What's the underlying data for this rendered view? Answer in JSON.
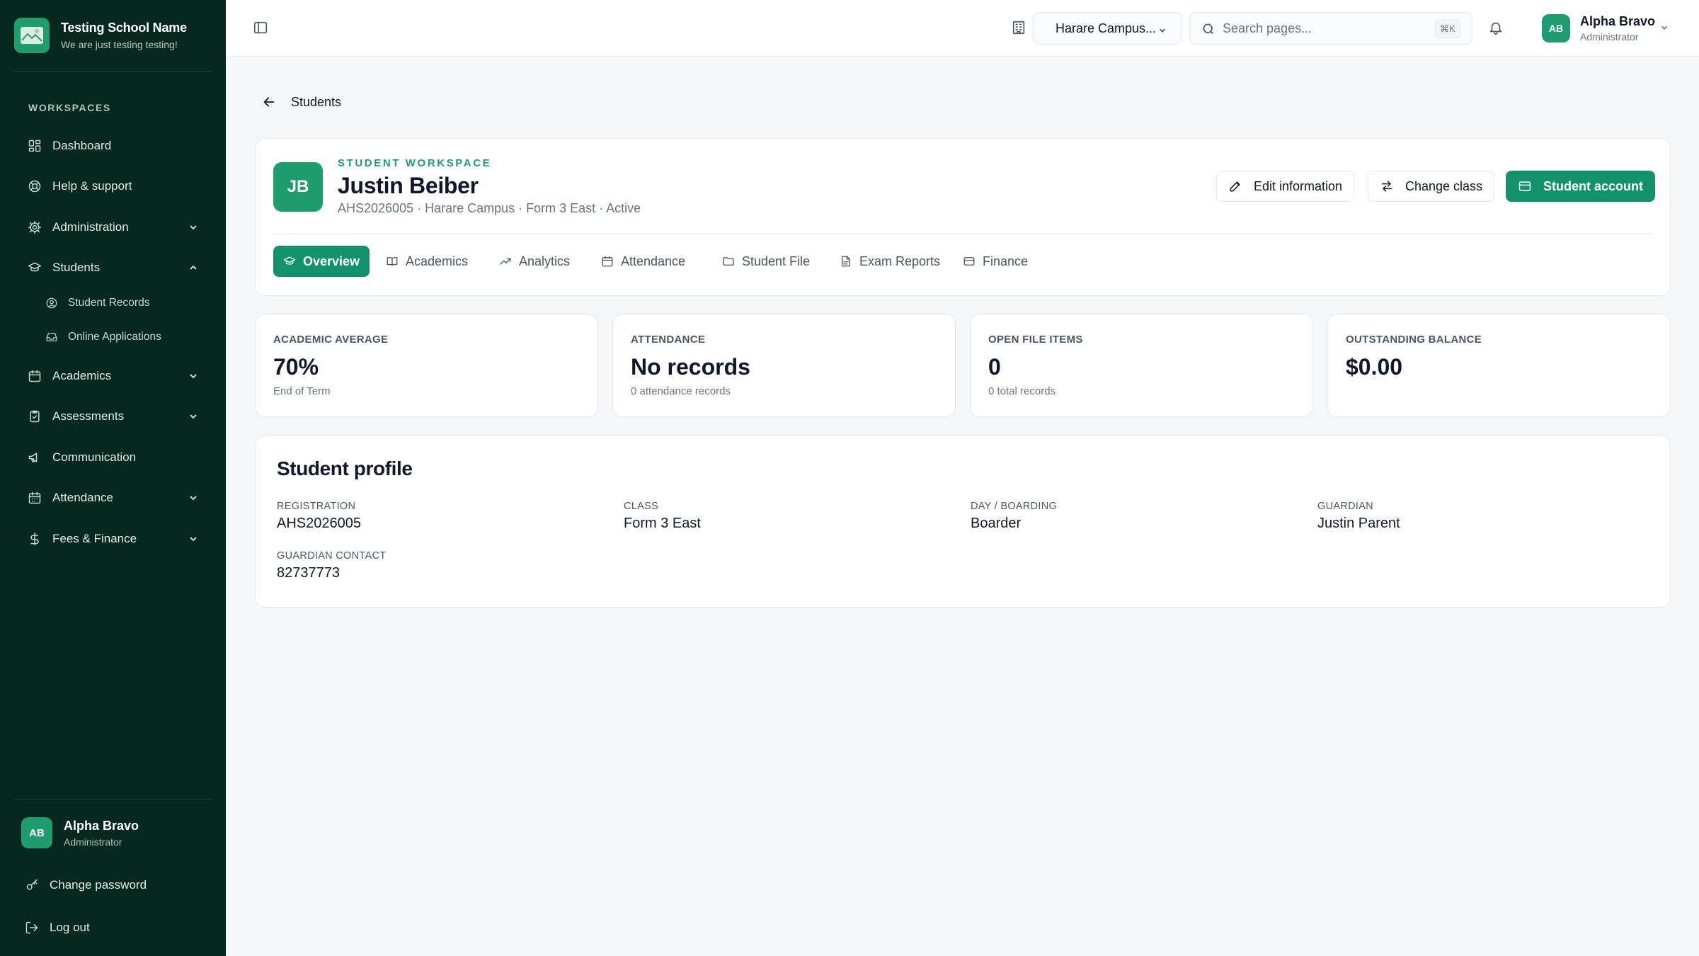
{
  "brand": {
    "title": "Testing School Name",
    "subtitle": "We are just testing testing!"
  },
  "sidebar": {
    "section_label": "WORKSPACES",
    "items": [
      {
        "label": "Dashboard",
        "icon": "grid-icon"
      },
      {
        "label": "Help & support",
        "icon": "lifebuoy-icon"
      },
      {
        "label": "Administration",
        "icon": "gear-icon",
        "expandable": true,
        "expanded": false
      },
      {
        "label": "Students",
        "icon": "graduation-cap-icon",
        "expandable": true,
        "expanded": true
      },
      {
        "label": "Academics",
        "icon": "calendar-icon",
        "expandable": true,
        "expanded": false
      },
      {
        "label": "Assessments",
        "icon": "clipboard-check-icon",
        "expandable": true,
        "expanded": false
      },
      {
        "label": "Communication",
        "icon": "megaphone-icon"
      },
      {
        "label": "Attendance",
        "icon": "calendar-grid-icon",
        "expandable": true,
        "expanded": false
      },
      {
        "label": "Fees & Finance",
        "icon": "dollar-icon",
        "expandable": true,
        "expanded": false
      }
    ],
    "students_sub": [
      {
        "label": "Student Records",
        "icon": "user-circle-icon"
      },
      {
        "label": "Online Applications",
        "icon": "inbox-icon"
      }
    ],
    "user": {
      "initials": "AB",
      "name": "Alpha Bravo",
      "role": "Administrator"
    },
    "change_password": "Change password",
    "logout": "Log out"
  },
  "topbar": {
    "campus": "Harare Campus...",
    "search_placeholder": "Search pages...",
    "shortcut": "⌘K",
    "user": {
      "initials": "AB",
      "name": "Alpha Bravo",
      "role": "Administrator"
    }
  },
  "breadcrumb": {
    "label": "Students"
  },
  "student": {
    "initials": "JB",
    "eyebrow": "STUDENT WORKSPACE",
    "name": "Justin Beiber",
    "description": "AHS2026005 · Harare Campus · Form 3 East · Active"
  },
  "actions": {
    "edit": "Edit information",
    "change_class": "Change class",
    "account": "Student account"
  },
  "tabs": [
    {
      "label": "Overview",
      "icon": "graduation-cap-icon",
      "active": true
    },
    {
      "label": "Academics",
      "icon": "book-icon"
    },
    {
      "label": "Analytics",
      "icon": "trending-up-icon"
    },
    {
      "label": "Attendance",
      "icon": "calendar-icon"
    },
    {
      "label": "Student File",
      "icon": "folder-icon"
    },
    {
      "label": "Exam Reports",
      "icon": "file-text-icon"
    },
    {
      "label": "Finance",
      "icon": "credit-card-icon"
    }
  ],
  "stats": [
    {
      "label": "ACADEMIC AVERAGE",
      "value": "70%",
      "sub": "End of Term"
    },
    {
      "label": "ATTENDANCE",
      "value": "No records",
      "sub": "0 attendance records"
    },
    {
      "label": "OPEN FILE ITEMS",
      "value": "0",
      "sub": "0 total records"
    },
    {
      "label": "OUTSTANDING BALANCE",
      "value": "$0.00",
      "sub": ""
    }
  ],
  "profile": {
    "title": "Student profile",
    "fields": [
      {
        "label": "REGISTRATION",
        "value": "AHS2026005"
      },
      {
        "label": "CLASS",
        "value": "Form 3 East"
      },
      {
        "label": "DAY / BOARDING",
        "value": "Boarder"
      },
      {
        "label": "GUARDIAN",
        "value": "Justin Parent"
      },
      {
        "label": "GUARDIAN CONTACT",
        "value": "82737773"
      }
    ]
  },
  "colors": {
    "sidebar_bg": "#06291f",
    "accent": "#13916a",
    "page_bg": "#f5f6f8"
  }
}
